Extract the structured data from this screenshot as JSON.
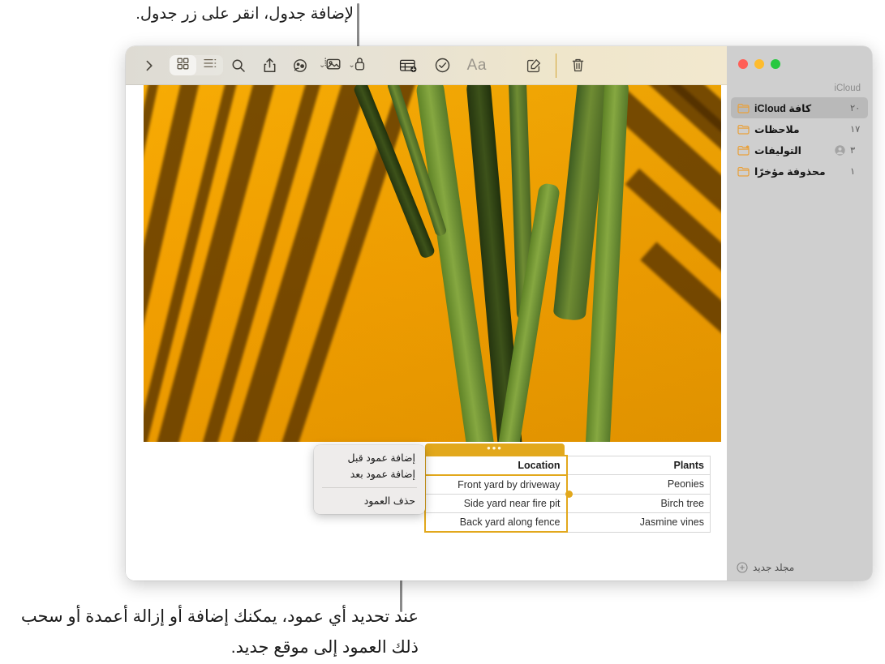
{
  "annotations": {
    "top": "لإضافة جدول، انقر على زر جدول.",
    "bottom": "عند تحديد أي عمود، يمكنك إضافة أو إزالة أعمدة أو سحب ذلك العمود إلى موقع جديد."
  },
  "window": {
    "traffic_lights": [
      "green",
      "yellow",
      "red"
    ]
  },
  "toolbar": {
    "search_label": "بحث",
    "share_label": "مشاركة",
    "collaborate_label": "تعاون",
    "media_label": "وسائط",
    "lock_label": "قفل",
    "table_label": "جدول",
    "checklist_label": "قائمة تحقق",
    "format_label": "Aa",
    "compose_label": "ملاحظة جديدة",
    "delete_label": "حذف",
    "expand_label": "توسيع",
    "grid_view_label": "عرض شبكي",
    "list_view_label": "عرض قائمة",
    "caret_label": "⌄"
  },
  "sidebar": {
    "section_title": "iCloud",
    "new_folder_label": "مجلد جديد",
    "items": [
      {
        "label": "كافة iCloud",
        "count": "٢٠",
        "shared": false,
        "selected": true
      },
      {
        "label": "ملاحظات",
        "count": "١٧",
        "shared": false,
        "selected": false
      },
      {
        "label": "التوليفات",
        "count": "٣",
        "shared": true,
        "selected": false
      },
      {
        "label": "محذوفة مؤخرًا",
        "count": "١",
        "shared": false,
        "selected": false
      }
    ]
  },
  "table": {
    "handle_dots": "•••",
    "columns": [
      "Plants",
      "Location"
    ],
    "rows": [
      [
        "Peonies",
        "Front yard by driveway"
      ],
      [
        "Birch tree",
        "Side yard near fire pit"
      ],
      [
        "Jasmine vines",
        "Back yard along fence"
      ]
    ],
    "selected_column_index": 1
  },
  "context_menu": {
    "items": [
      "إضافة عمود قبل",
      "إضافة عمود بعد"
    ],
    "destructive": "حذف العمود"
  },
  "colors": {
    "accent_gold": "#e2a81c",
    "folder_orange": "#e9a13b",
    "sidebar_bg": "#cfcfcf",
    "selected_row": "#b9b9b9",
    "photo_wall": "#f3a001"
  }
}
